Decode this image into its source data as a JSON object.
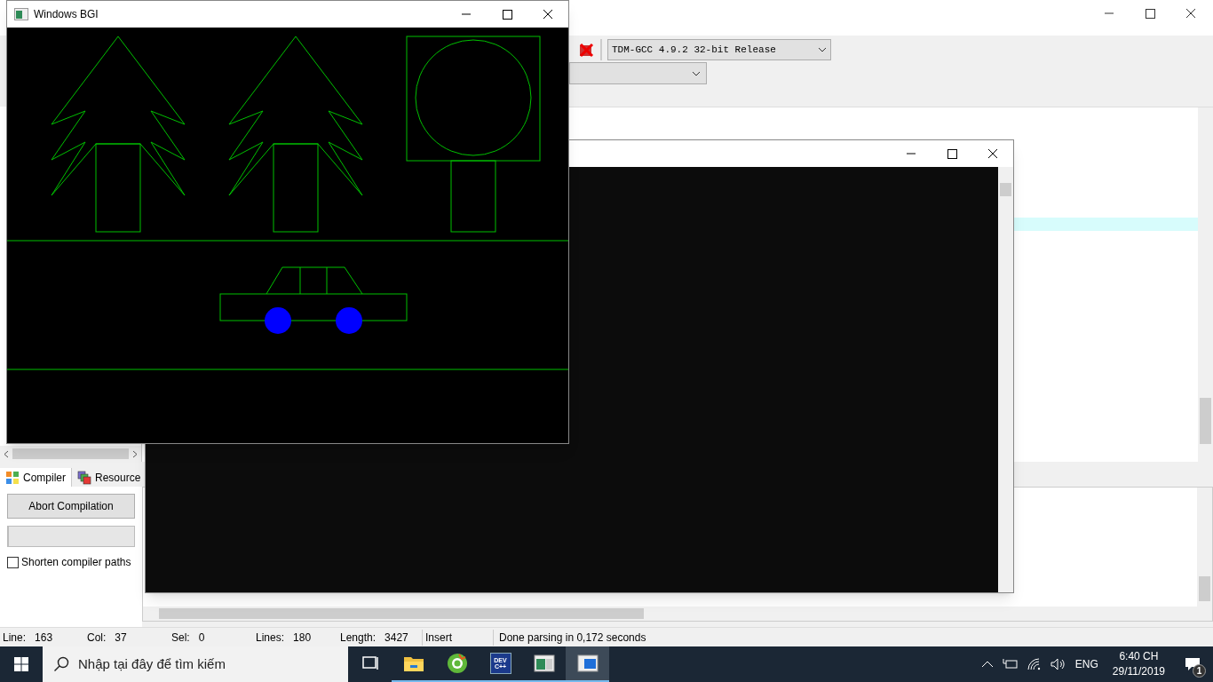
{
  "ide": {
    "compiler_select": "TDM-GCC 4.9.2 32-bit Release",
    "bottom_tabs": [
      {
        "label": "Compiler",
        "selected": true
      },
      {
        "label": "Resource",
        "selected": false
      }
    ],
    "abort_button": "Abort Compilation",
    "progress": {
      "level": 0
    },
    "shorten_paths": {
      "label": "Shorten compiler paths",
      "checked": false
    },
    "status_bar": [
      {
        "label": "Line:",
        "value": "163"
      },
      {
        "label": "Col:",
        "value": "37"
      },
      {
        "label": "Sel:",
        "value": "0"
      },
      {
        "label": "Lines:",
        "value": "180"
      },
      {
        "label": "Length:",
        "value": "3427"
      },
      {
        "value": "Insert"
      },
      {
        "value": "Done parsing in 0,172 seconds"
      }
    ]
  },
  "bgi_window": {
    "title": "Windows BGI"
  },
  "taskbar": {
    "search_placeholder": "Nhập tại đây để tìm kiếm",
    "apps": [
      {
        "kind": "taskview",
        "running": false,
        "selected": false
      },
      {
        "kind": "folder",
        "running": true,
        "selected": false
      },
      {
        "kind": "browser",
        "running": true,
        "selected": false
      },
      {
        "kind": "devcpp",
        "running": true,
        "selected": false,
        "logo_text": [
          "DEV",
          "C++"
        ]
      },
      {
        "kind": "bgi",
        "running": true,
        "selected": false
      },
      {
        "kind": "console",
        "running": true,
        "selected": true
      }
    ],
    "language": "ENG",
    "time": "6:40 CH",
    "date": "29/11/2019",
    "notifications": "1"
  }
}
